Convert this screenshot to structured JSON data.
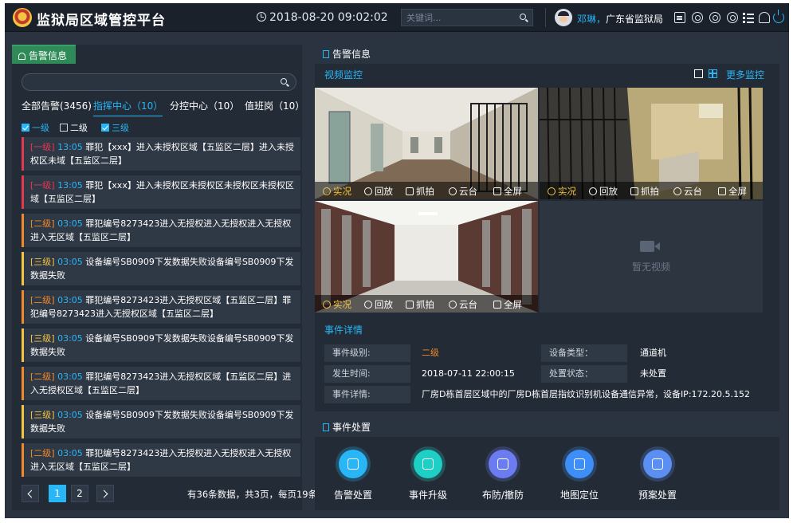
{
  "header": {
    "app_title": "监狱局区域管控平台",
    "datetime": "2018-08-20 09:02:02",
    "search_placeholder": "关键词...",
    "user_name": "邓琳",
    "user_sep": "，",
    "user_org": "广东省监狱局",
    "icons": [
      "shield-logo-icon",
      "clock-icon",
      "search-icon",
      "avatar",
      "message-icon",
      "circle-icon",
      "circle-icon",
      "settings-icon",
      "list-icon",
      "user-icon",
      "power-icon"
    ]
  },
  "left_panel": {
    "tab_label": "告警信息",
    "tabs": [
      "全部告警(3456)",
      "指挥中心（10）",
      "分控中心（10）",
      "值班岗（10）"
    ],
    "active_tab": 1,
    "filters": [
      {
        "label": "一级",
        "checked": true
      },
      {
        "label": "二级",
        "checked": false
      },
      {
        "label": "三级",
        "checked": true
      }
    ],
    "alerts": [
      {
        "level": "[一级]",
        "time": "13:05",
        "text": " 罪犯【xxx】进入未授权区域【五监区二层】进入未授权区未域【五监区二层】"
      },
      {
        "level": "[一级]",
        "time": "13:05",
        "text": " 罪犯【xxx】进入未授权区未授权区未授权区未授权区域【五监区二层】"
      },
      {
        "level": "[二级]",
        "time": "03:05",
        "text": " 罪犯编号8273423进入无授权进入无授权进入无授权进入无区域【五监区二层】"
      },
      {
        "level": "[三级]",
        "time": "03:05",
        "text": " 设备编号SB0909下发数据失败设备编号SB0909下发数据失败"
      },
      {
        "level": "[二级]",
        "time": "03:05",
        "text": " 罪犯编号8273423进入无授权区域【五监区二层】罪犯编号8273423进入无授权区域【五监区二层】"
      },
      {
        "level": "[三级]",
        "time": "03:05",
        "text": " 设备编号SB0909下发数据失败设备编号SB0909下发数据失败"
      },
      {
        "level": "[二级]",
        "time": "03:05",
        "text": " 罪犯编号8273423进入无授权区域【五监区二层】进入无授权区域【五监区二层】"
      },
      {
        "level": "[三级]",
        "time": "03:05",
        "text": " 设备编号SB0909下发数据失败设备编号SB0909下发数据失败"
      },
      {
        "level": "[二级]",
        "time": "03:05",
        "text": " 罪犯编号8273423进入无授权进入无授权进入无授权进入无区域【五监区二层】"
      }
    ],
    "pagination": {
      "pages": [
        "1",
        "2"
      ],
      "active_page": "1",
      "info": "有36条数据，共3页，每页19条"
    }
  },
  "alarm_panel": {
    "title": "告警信息",
    "video_section_title": "视频监控",
    "more_label": "更多监控",
    "video_controls": [
      "实况",
      "回放",
      "抓拍",
      "云台",
      "全屏"
    ],
    "no_video_text": "暂无视频",
    "event_section_title": "事件详情",
    "event": {
      "level_label": "事件级别:",
      "level_value": "二级",
      "device_type_label": "设备类型：",
      "device_type_value": "通道机",
      "time_label": "发生时间:",
      "time_value": "2018-07-11 22:00:15",
      "status_label": "处置状态：",
      "status_value": "未处置",
      "detail_label": "事件详情:",
      "detail_value": "厂房D栋首层区域中的厂房D栋首层指纹识别机设备通信异常，设备IP:172.20.5.152"
    }
  },
  "handling_panel": {
    "title": "事件处置",
    "actions": [
      {
        "label": "告警处置",
        "icon": "layers-icon",
        "color": "#29b6f6"
      },
      {
        "label": "事件升级",
        "icon": "upgrade-icon",
        "color": "#1ecfc5"
      },
      {
        "label": "布防/撤防",
        "icon": "shield-check-icon",
        "color": "#6b7cf0"
      },
      {
        "label": "地图定位",
        "icon": "location-arrow-icon",
        "color": "#3d8ef7"
      },
      {
        "label": "预案处置",
        "icon": "plan-icon",
        "color": "#5b8ff2"
      }
    ]
  },
  "colors": {
    "accent": "#29b6f6",
    "level1": "#e53950",
    "level2": "#f28a2b",
    "level3": "#f4c542",
    "active_tab_bg": "#2e8b57"
  }
}
